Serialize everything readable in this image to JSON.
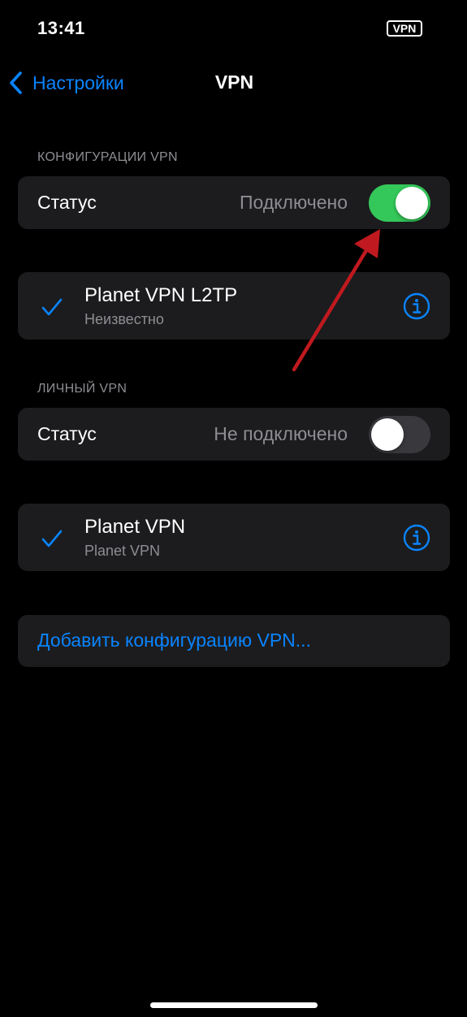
{
  "status_bar": {
    "time": "13:41",
    "vpn_badge": "VPN"
  },
  "nav": {
    "back_label": "Настройки",
    "title": "VPN"
  },
  "vpn_configs": {
    "header": "КОНФИГУРАЦИИ VPN",
    "status_label": "Статус",
    "status_value": "Подключено",
    "toggle_on": true,
    "item": {
      "name": "Planet VPN L2TP",
      "subtitle": "Неизвестно",
      "selected": true
    }
  },
  "personal_vpn": {
    "header": "ЛИЧНЫЙ VPN",
    "status_label": "Статус",
    "status_value": "Не подключено",
    "toggle_on": false,
    "item": {
      "name": "Planet VPN",
      "subtitle": "Planet VPN",
      "selected": true
    }
  },
  "add_config_label": "Добавить конфигурацию VPN...",
  "colors": {
    "accent": "#0a84ff",
    "toggle_on": "#34c759",
    "toggle_off": "#39393d",
    "card_bg": "#1c1c1e",
    "annotation_arrow": "#c0191f"
  },
  "icons": {
    "back": "chevron-left-icon",
    "check": "checkmark-icon",
    "info": "info-circle-icon"
  }
}
